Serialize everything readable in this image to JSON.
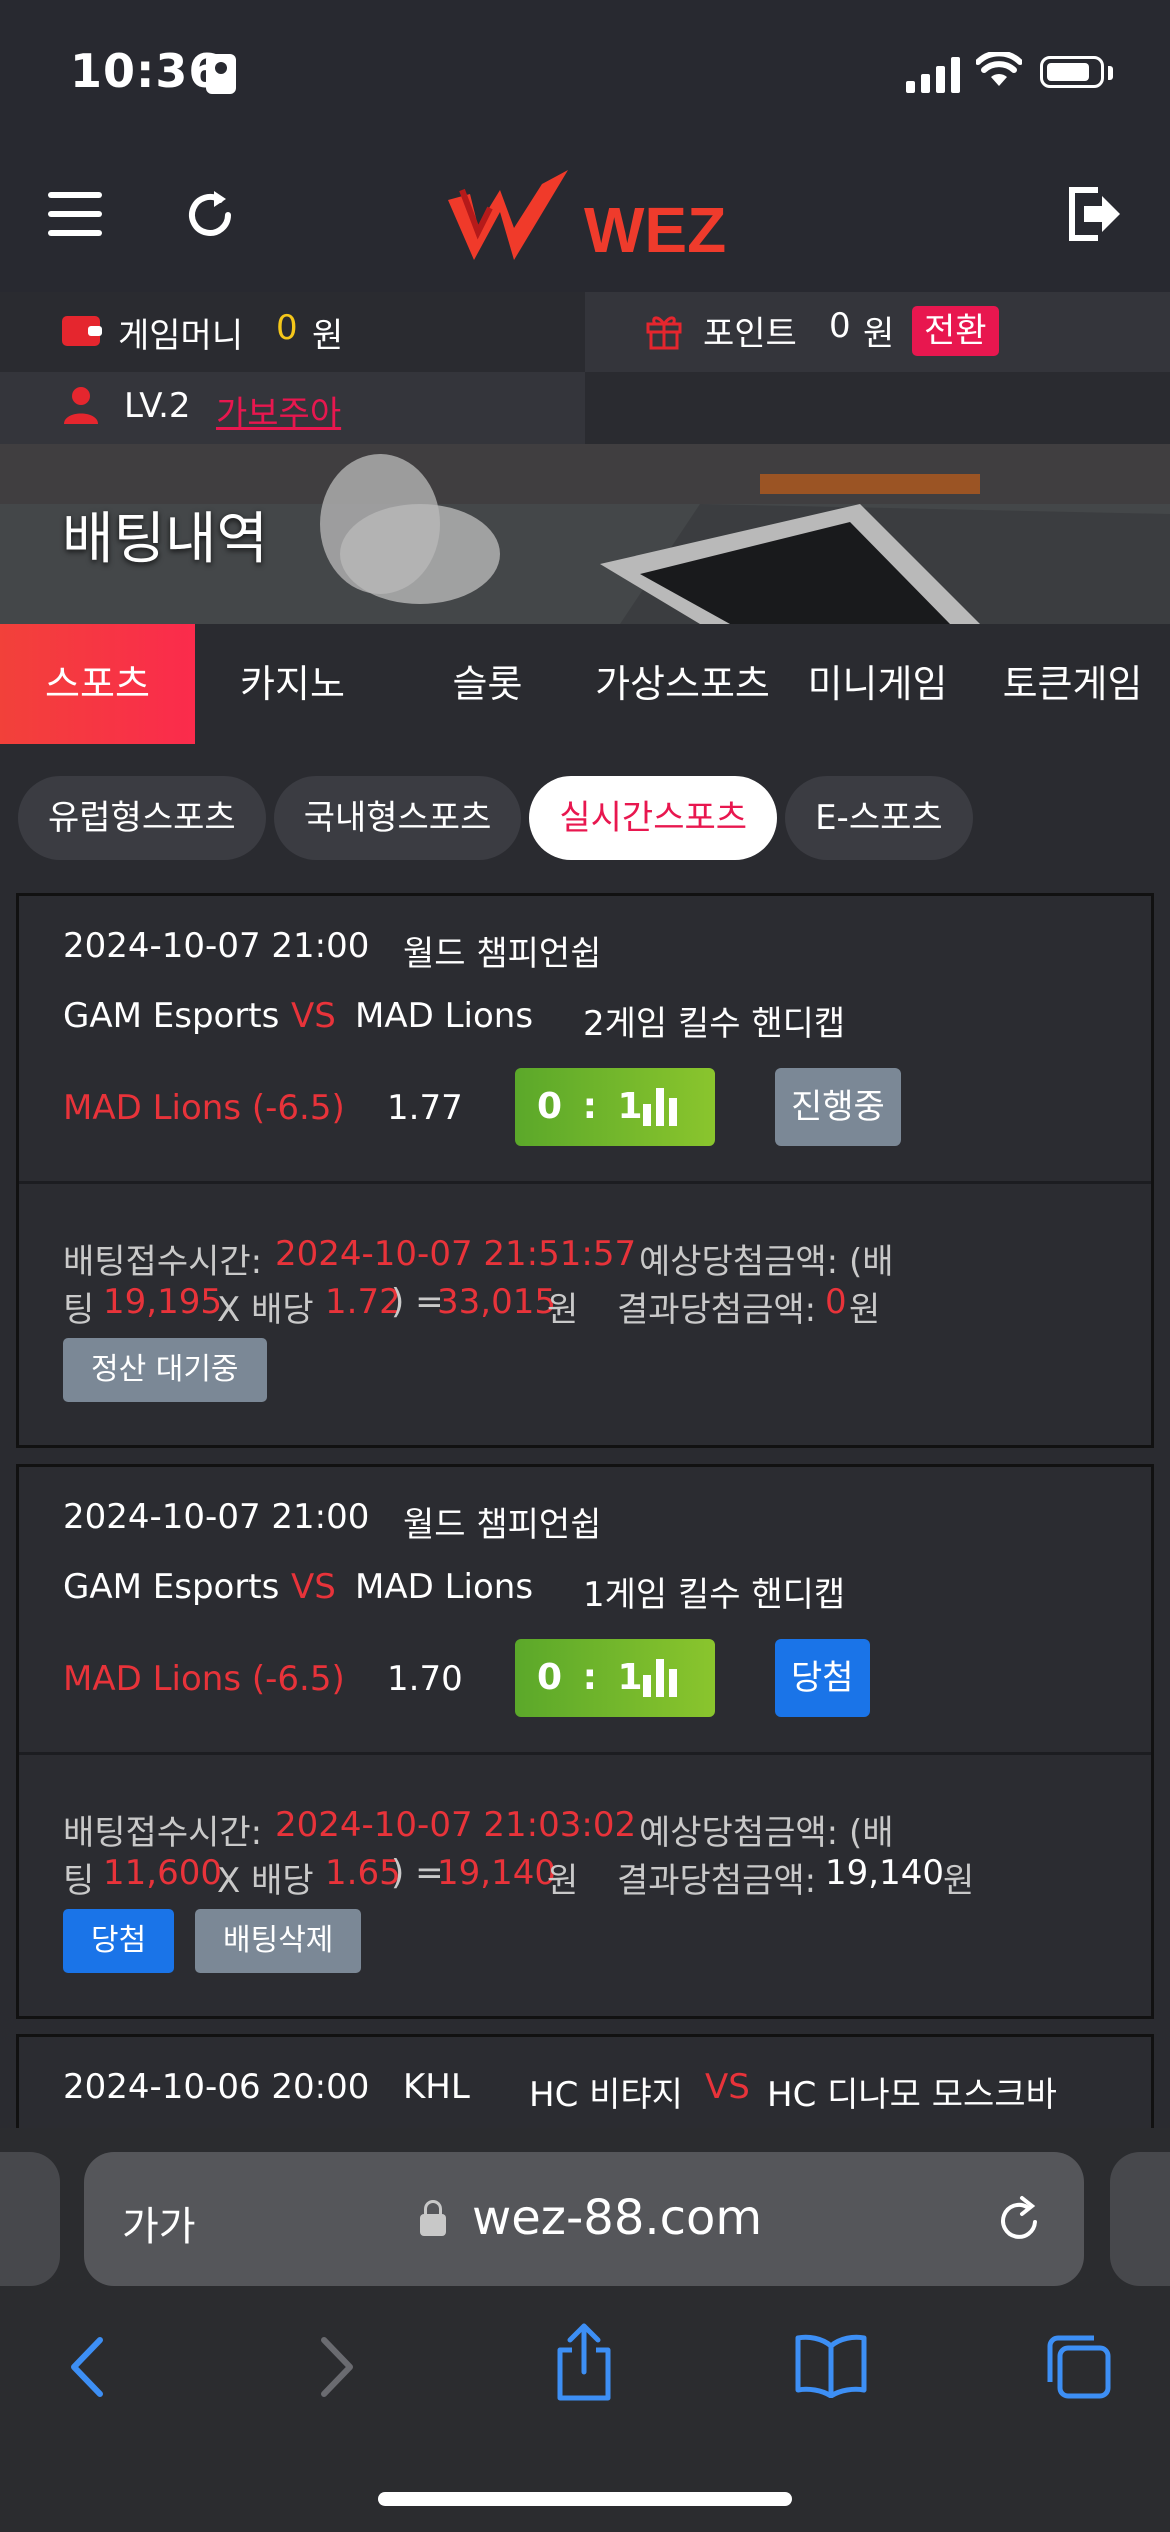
{
  "status_bar": {
    "time": "10:36"
  },
  "header": {
    "logo_text": "WEZ"
  },
  "account": {
    "money_label": "게임머니",
    "money_value": "0",
    "money_unit": "원",
    "point_label": "포인트",
    "point_value": "0",
    "point_unit": "원",
    "convert_label": "전환",
    "level": "LV.2",
    "level_name": "가보주아"
  },
  "banner": {
    "title": "배팅내역"
  },
  "tabs": [
    {
      "label": "스포츠",
      "active": true
    },
    {
      "label": "카지노"
    },
    {
      "label": "슬롯"
    },
    {
      "label": "가상스포츠"
    },
    {
      "label": "미니게임"
    },
    {
      "label": "토큰게임"
    }
  ],
  "subtabs": [
    {
      "label": "유럽형스포츠"
    },
    {
      "label": "국내형스포츠"
    },
    {
      "label": "실시간스포츠",
      "active": true
    },
    {
      "label": "E-스포츠"
    }
  ],
  "bets": [
    {
      "datetime": "2024-10-07 21:00",
      "league": "월드 챔피언쉽",
      "home": "GAM Esports",
      "vs": "VS",
      "away": "MAD Lions",
      "market": "2게임 킬수 핸디캡",
      "pick": "MAD Lions (-6.5)",
      "odds": "1.77",
      "score": "0 : 1",
      "status": "진행중",
      "accept_label": "배팅접수시간:",
      "accept_time": "2024-10-07 21:51:57",
      "expected_label": "예상당첨금액: (배",
      "bet_prefix": "팅",
      "stake": "19,195",
      "x_label": "X 배당",
      "rate": "1.72",
      "eq": ") =",
      "expected_amount": "33,015",
      "won": "원",
      "result_label": "결과당첨금액:",
      "result_amount": "0",
      "result_unit": "원",
      "buttons": [
        "정산 대기중"
      ]
    },
    {
      "datetime": "2024-10-07 21:00",
      "league": "월드 챔피언쉽",
      "home": "GAM Esports",
      "vs": "VS",
      "away": "MAD Lions",
      "market": "1게임 킬수 핸디캡",
      "pick": "MAD Lions (-6.5)",
      "odds": "1.70",
      "score": "0 : 1",
      "status": "당첨",
      "accept_label": "배팅접수시간:",
      "accept_time": "2024-10-07 21:03:02",
      "expected_label": "예상당첨금액: (배",
      "bet_prefix": "팅",
      "stake": "11,600",
      "x_label": "X 배당",
      "rate": "1.65",
      "eq": ") =",
      "expected_amount": "19,140",
      "won": "원",
      "result_label": "결과당첨금액:",
      "result_amount": "19,140",
      "result_unit": "원",
      "buttons": [
        "당첨",
        "배팅삭제"
      ]
    },
    {
      "datetime": "2024-10-06 20:00",
      "league": "KHL",
      "home": "HC 비탸지",
      "vs": "VS",
      "away": "HC 디나모 모스크바"
    }
  ],
  "browser": {
    "text_size": "가가",
    "url": "wez-88.com"
  },
  "colors": {
    "accent_red": "#e8174f",
    "score_green": "#7ab82c",
    "win_blue": "#1a74e8",
    "pending_grey": "#7b8896"
  }
}
